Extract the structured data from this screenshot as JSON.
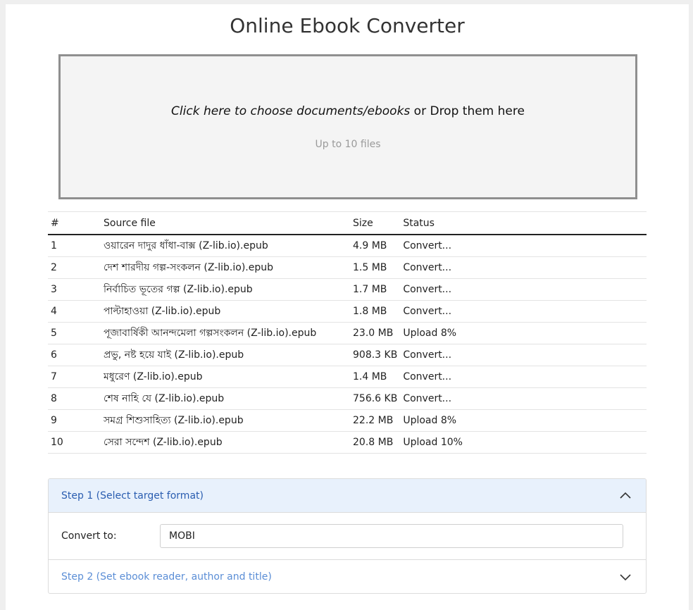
{
  "app": {
    "title": "Online Ebook Converter"
  },
  "dropzone": {
    "prompt_italic": "Click here to choose documents/ebooks",
    "prompt_rest": " or Drop them here",
    "limit_text": "Up to 10 files"
  },
  "table": {
    "headers": {
      "num": "#",
      "source": "Source file",
      "size": "Size",
      "status": "Status"
    },
    "rows": [
      {
        "num": "1",
        "source": "ওয়ারেন দাদুর ধাঁধা-বাক্স (Z-lib.io).epub",
        "size": "4.9 MB",
        "status": "Convert..."
      },
      {
        "num": "2",
        "source": "দেশ শারদীয় গল্প-সংকলন (Z-lib.io).epub",
        "size": "1.5 MB",
        "status": "Convert..."
      },
      {
        "num": "3",
        "source": "নির্বাচিত ভূতের গল্প (Z-lib.io).epub",
        "size": "1.7 MB",
        "status": "Convert..."
      },
      {
        "num": "4",
        "source": "পাল্টাহাওয়া (Z-lib.io).epub",
        "size": "1.8 MB",
        "status": "Convert..."
      },
      {
        "num": "5",
        "source": "পূজাবার্ষিকী আনন্দমেলা গল্পসংকলন (Z-lib.io).epub",
        "size": "23.0 MB",
        "status": "Upload 8%"
      },
      {
        "num": "6",
        "source": "প্রভু, নষ্ট হয়ে যাই (Z-lib.io).epub",
        "size": "908.3 KB",
        "status": "Convert..."
      },
      {
        "num": "7",
        "source": "মধুরেণ (Z-lib.io).epub",
        "size": "1.4 MB",
        "status": "Convert..."
      },
      {
        "num": "8",
        "source": "শেষ নাহি যে (Z-lib.io).epub",
        "size": "756.6 KB",
        "status": "Convert..."
      },
      {
        "num": "9",
        "source": "সমগ্র শিশুসাহিত্য (Z-lib.io).epub",
        "size": "22.2 MB",
        "status": "Upload 8%"
      },
      {
        "num": "10",
        "source": "সেরা সন্দেশ (Z-lib.io).epub",
        "size": "20.8 MB",
        "status": "Upload 10%"
      }
    ]
  },
  "steps": {
    "step1": {
      "label": "Step 1 (Select target format)",
      "icon": "chevron-up-icon",
      "convert_label": "Convert to:",
      "convert_value": "MOBI"
    },
    "step2": {
      "label": "Step 2 (Set ebook reader, author and title)",
      "icon": "chevron-down-icon"
    }
  },
  "colors": {
    "accent": "#2a5db0",
    "accent_light": "#5b8ed6",
    "open_header_bg": "#e8f1fc",
    "dropzone_border": "#8f8f8f"
  }
}
